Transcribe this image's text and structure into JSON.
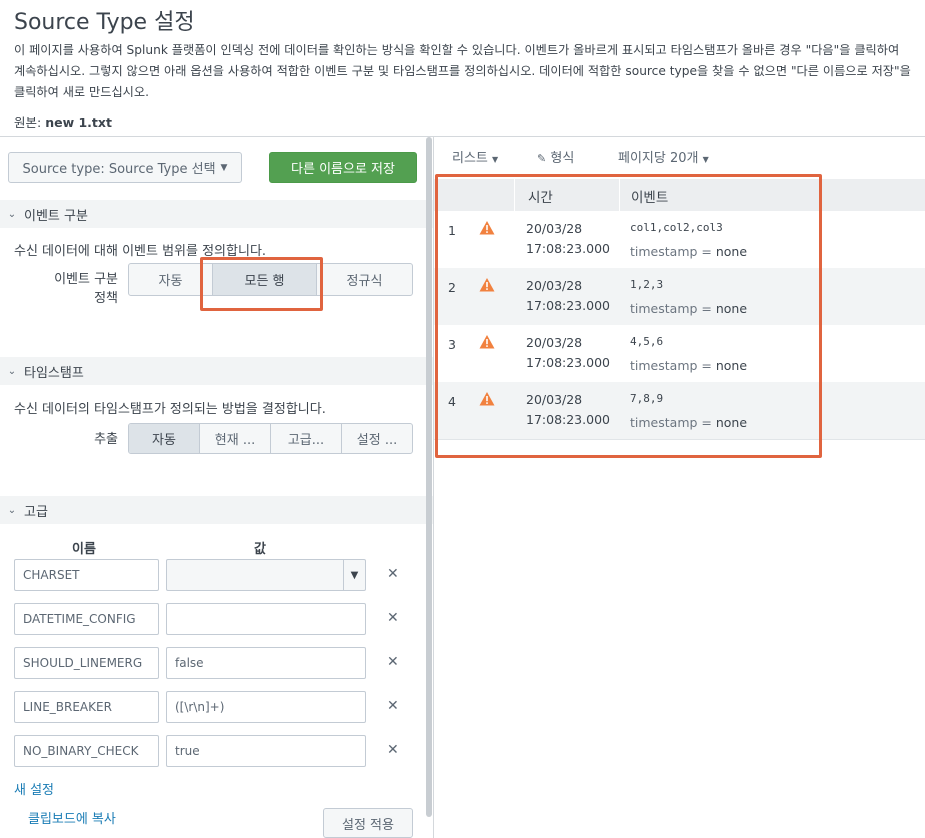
{
  "header": {
    "title": "Source Type 설정",
    "description": "이 페이지를 사용하여 Splunk 플랫폼이 인덱싱 전에 데이터를 확인하는 방식을 확인할 수 있습니다. 이벤트가 올바르게 표시되고 타임스탬프가 올바른 경우 \"다음\"을 클릭하여 계속하십시오. 그렇지 않으면 아래 옵션을 사용하여 적합한 이벤트 구분 및 타임스탬프를 정의하십시오. 데이터에 적합한 source type을 찾을 수 없으면 \"다른 이름으로 저장\"을 클릭하여 새로 만드십시오.",
    "source_label": "원본:",
    "source_value": "new 1.txt"
  },
  "left": {
    "sourcetype_button": "Source type: Source Type 선택",
    "save_as_button": "다른 이름으로 저장",
    "event_break": {
      "section_title": "이벤트 구분",
      "help": "수신 데이터에 대해 이벤트 범위를 정의합니다.",
      "policy_label_line1": "이벤트 구분",
      "policy_label_line2": "정책",
      "options": [
        "자동",
        "모든 행",
        "정규식"
      ],
      "selected": "모든 행"
    },
    "timestamp": {
      "section_title": "타임스탬프",
      "help": "수신 데이터의 타임스탬프가 정의되는 방법을 결정합니다.",
      "extract_label": "추출",
      "options": [
        "자동",
        "현재 ...",
        "고급...",
        "설정 ..."
      ],
      "selected": "자동"
    },
    "advanced": {
      "section_title": "고급",
      "col_name": "이름",
      "col_value": "값",
      "rows": [
        {
          "name": "CHARSET",
          "value": "",
          "type": "select"
        },
        {
          "name": "DATETIME_CONFIG",
          "value": "",
          "type": "text"
        },
        {
          "name": "SHOULD_LINEMERG",
          "value": "false",
          "type": "text"
        },
        {
          "name": "LINE_BREAKER",
          "value": "([\\r\\n]+)",
          "type": "text"
        },
        {
          "name": "NO_BINARY_CHECK",
          "value": "true",
          "type": "text"
        }
      ],
      "new_setting": "새 설정",
      "copy_clipboard": "클립보드에 복사",
      "apply": "설정 적용"
    }
  },
  "right": {
    "toolbar": {
      "list": "리스트",
      "format": "형식",
      "per_page": "페이지당 20개"
    },
    "table": {
      "col_time": "시간",
      "col_event": "이벤트",
      "rows": [
        {
          "num": "1",
          "date": "20/03/28",
          "time": "17:08:23.000",
          "event": "col1,col2,col3",
          "ts_key": "timestamp =",
          "ts_val": "none"
        },
        {
          "num": "2",
          "date": "20/03/28",
          "time": "17:08:23.000",
          "event": "1,2,3",
          "ts_key": "timestamp =",
          "ts_val": "none"
        },
        {
          "num": "3",
          "date": "20/03/28",
          "time": "17:08:23.000",
          "event": "4,5,6",
          "ts_key": "timestamp =",
          "ts_val": "none"
        },
        {
          "num": "4",
          "date": "20/03/28",
          "time": "17:08:23.000",
          "event": "7,8,9",
          "ts_key": "timestamp =",
          "ts_val": "none"
        }
      ]
    }
  },
  "colors": {
    "accent_green": "#53a051",
    "highlight_red": "#e0643f",
    "warning_orange": "#f1813f",
    "link_blue": "#1a7cb5"
  }
}
